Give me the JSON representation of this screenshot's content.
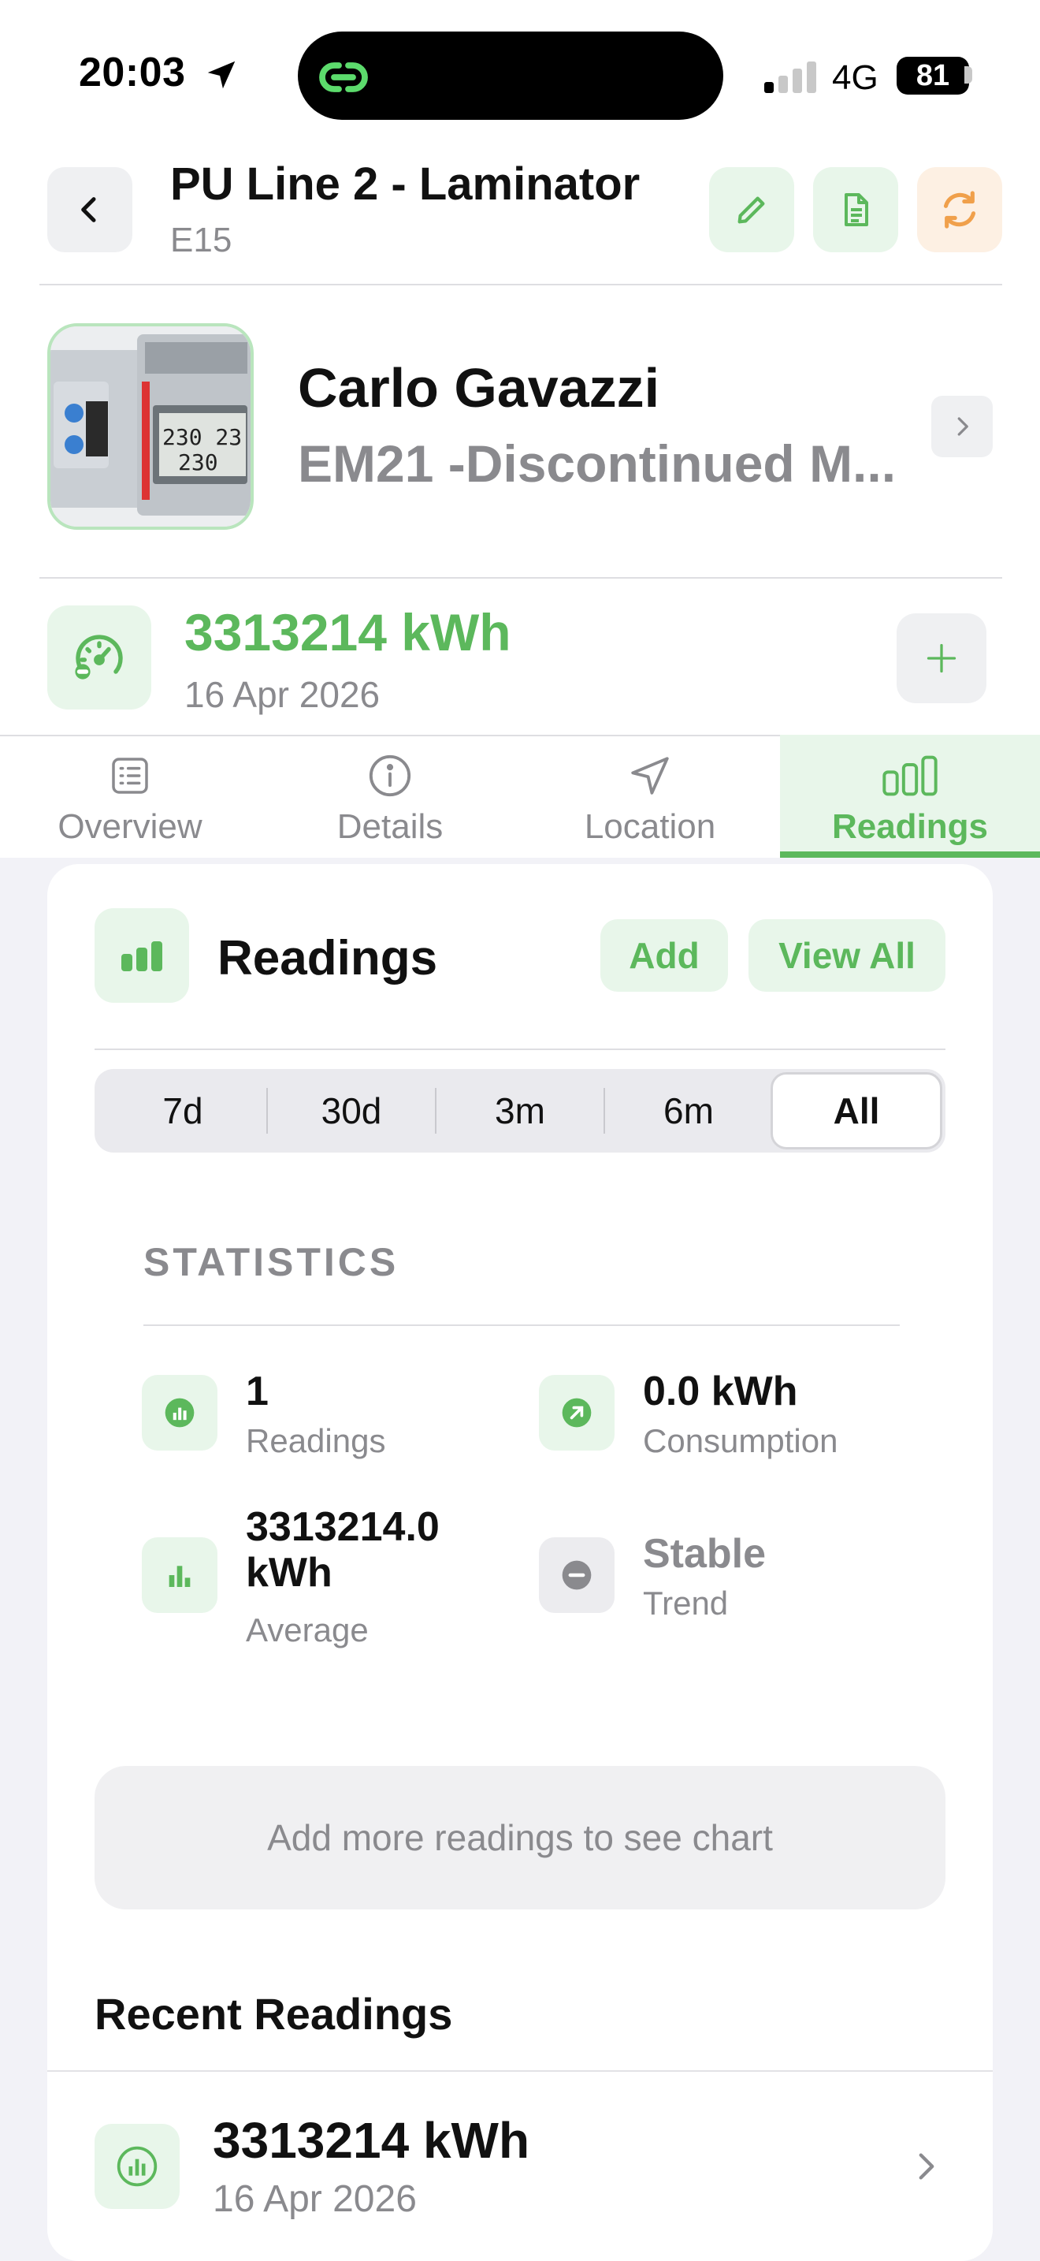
{
  "status_bar": {
    "time": "20:03",
    "network": "4G",
    "battery": "81"
  },
  "header": {
    "title": "PU Line 2 - Laminator",
    "subtitle": "E15"
  },
  "product": {
    "brand": "Carlo Gavazzi",
    "model": "EM21 -Discontinued M..."
  },
  "meter": {
    "value": "3313214 kWh",
    "date": "16 Apr 2026"
  },
  "tabs": [
    {
      "label": "Overview",
      "icon": "list-icon"
    },
    {
      "label": "Details",
      "icon": "info-icon"
    },
    {
      "label": "Location",
      "icon": "navigation-icon"
    },
    {
      "label": "Readings",
      "icon": "bar-chart-icon",
      "active": true
    }
  ],
  "readings": {
    "title": "Readings",
    "add_label": "Add",
    "view_all_label": "View All",
    "ranges": [
      "7d",
      "30d",
      "3m",
      "6m",
      "All"
    ],
    "selected_range": "All"
  },
  "statistics": {
    "header": "STATISTICS",
    "readings_count": "1",
    "readings_label": "Readings",
    "consumption_value": "0.0 kWh",
    "consumption_label": "Consumption",
    "average_value_line1": "3313214.0",
    "average_value_line2": "kWh",
    "average_label": "Average",
    "trend_value": "Stable",
    "trend_label": "Trend"
  },
  "chart_placeholder": "Add more readings to see chart",
  "recent": {
    "title": "Recent Readings",
    "items": [
      {
        "value": "3313214 kWh",
        "date": "16 Apr 2026"
      }
    ]
  },
  "colors": {
    "accent": "#5cb85c",
    "accent_bg": "#e8f6ea",
    "orange": "#f0a04b",
    "grey_text": "#8a8a8e"
  }
}
